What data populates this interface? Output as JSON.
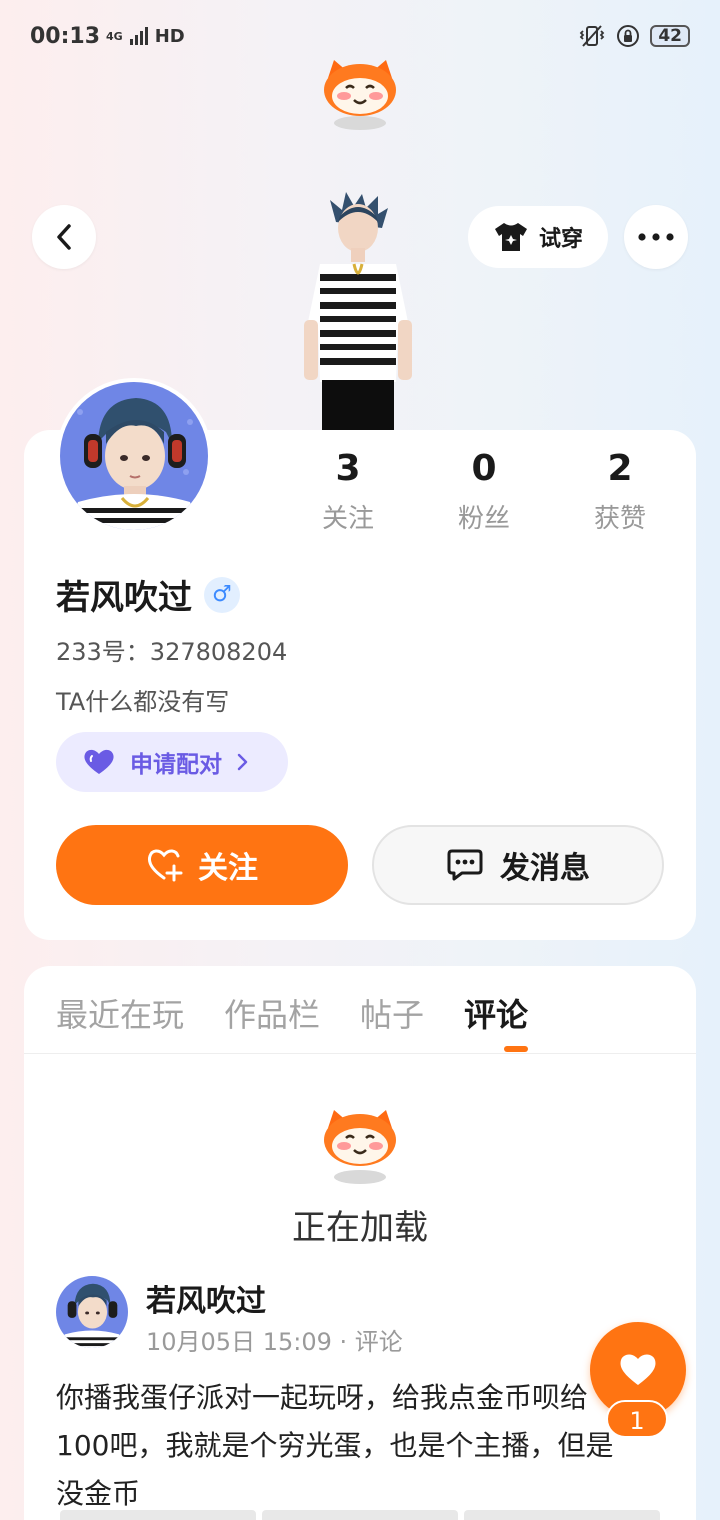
{
  "status_bar": {
    "time": "00:13",
    "network": "4G",
    "hd": "HD",
    "battery": "42"
  },
  "header": {
    "try_on_label": "试穿"
  },
  "profile": {
    "stats": [
      {
        "value": "3",
        "label": "关注"
      },
      {
        "value": "0",
        "label": "粉丝"
      },
      {
        "value": "2",
        "label": "获赞"
      }
    ],
    "username": "若风吹过",
    "gender_symbol": "♂",
    "uid": "233号：327808204",
    "bio": "TA什么都没有写",
    "pair_label": "申请配对",
    "follow_label": "关注",
    "message_label": "发消息"
  },
  "tabs": [
    {
      "label": "最近在玩",
      "active": false
    },
    {
      "label": "作品栏",
      "active": false
    },
    {
      "label": "帖子",
      "active": false
    },
    {
      "label": "评论",
      "active": true
    }
  ],
  "loading_text": "正在加载",
  "comment": {
    "author": "若风吹过",
    "meta": "10月05日 15:09 · 评论",
    "text": "你播我蛋仔派对一起玩呀，给我点金币呗给100吧，我就是个穷光蛋，也是个主播，但是没金币",
    "like_count": "1"
  },
  "colors": {
    "accent": "#ff7412",
    "pair": "#6a5be4",
    "gender": "#3d8bff"
  }
}
